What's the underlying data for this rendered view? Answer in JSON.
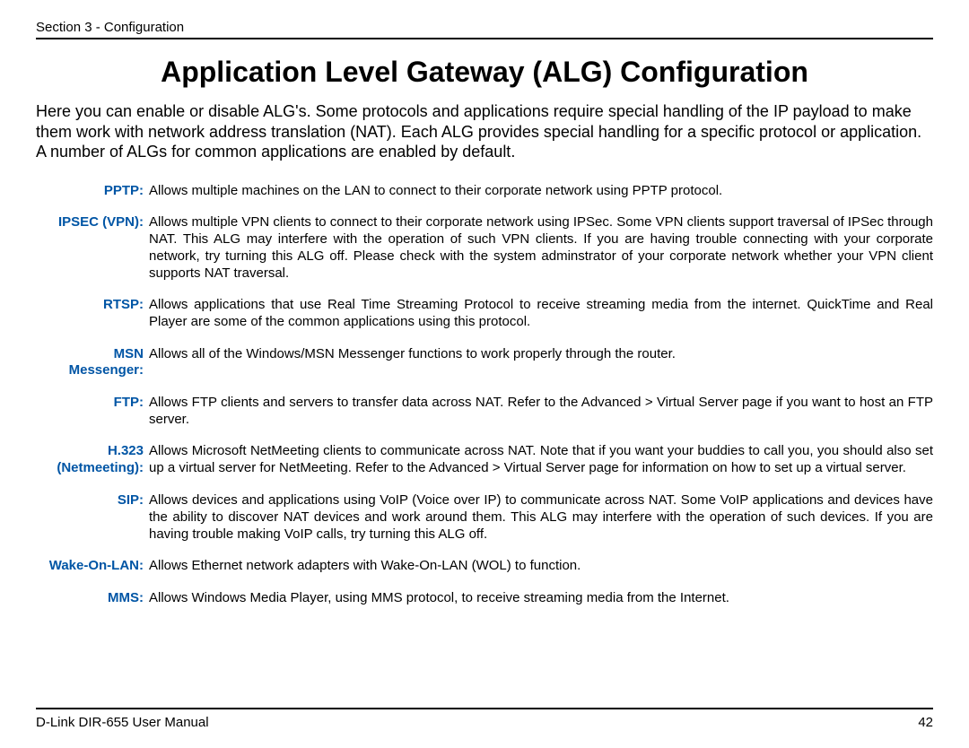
{
  "header": "Section 3 - Configuration",
  "title": "Application Level Gateway (ALG) Configuration",
  "intro": "Here you can enable or disable ALG's. Some protocols and applications require special handling of the IP payload to make them work with network address translation (NAT). Each ALG provides special handling for a specific protocol or application. A number of ALGs for common applications are enabled by default.",
  "items": [
    {
      "label": "PPTP:",
      "desc": "Allows multiple machines on the LAN to connect to their corporate network using PPTP protocol."
    },
    {
      "label": "IPSEC (VPN):",
      "desc": "Allows multiple VPN clients to connect to their corporate network using IPSec. Some VPN clients support traversal of IPSec through NAT. This ALG may interfere with the operation of such VPN clients. If you are having trouble connecting with your corporate network, try turning this ALG off. Please check with the system adminstrator of your corporate network whether your VPN client supports NAT traversal."
    },
    {
      "label": "RTSP:",
      "desc": "Allows applications that use Real Time Streaming Protocol to receive streaming media from the internet. QuickTime and Real Player are some of the common applications using this protocol."
    },
    {
      "label": "MSN Messenger:",
      "desc": "Allows all of the Windows/MSN Messenger functions to work properly through the router."
    },
    {
      "label": "FTP:",
      "desc": "Allows FTP clients and servers to transfer data across NAT. Refer to the Advanced > Virtual Server page if you want to host an FTP server."
    },
    {
      "label": "H.323 (Netmeeting):",
      "desc": "Allows Microsoft NetMeeting clients to communicate across NAT. Note that if you want your buddies to call you, you should also set up a virtual server for NetMeeting. Refer to the Advanced > Virtual Server page for information on how to set up a virtual server."
    },
    {
      "label": "SIP:",
      "desc": "Allows devices and applications using VoIP (Voice over IP) to communicate across NAT. Some VoIP applications and devices have the ability to discover NAT devices and work around them. This ALG may interfere with the operation of such devices. If you are having trouble making VoIP calls, try turning this ALG off."
    },
    {
      "label": "Wake-On-LAN:",
      "desc": "Allows Ethernet network adapters with Wake-On-LAN (WOL) to function."
    },
    {
      "label": "MMS:",
      "desc": "Allows Windows Media Player, using MMS protocol, to receive streaming media from the Internet."
    }
  ],
  "footer_left": "D-Link DIR-655 User Manual",
  "footer_right": "42"
}
